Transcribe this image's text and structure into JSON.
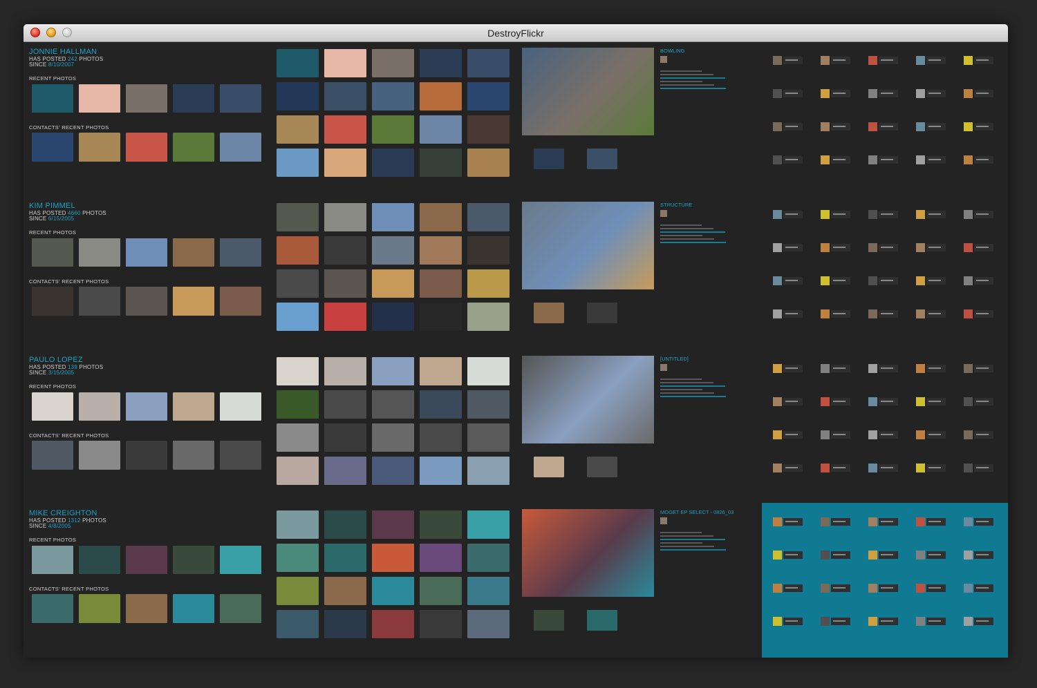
{
  "window": {
    "title": "DestroyFlickr"
  },
  "sections": [
    {
      "name": "JONNIE HALLMAN",
      "posted_prefix": "HAS POSTED",
      "count": "242",
      "posted_suffix": "PHOTOS",
      "since_prefix": "SINCE",
      "since": "8/10/2007",
      "recent_label": "RECENT PHOTOS",
      "contacts_label": "CONTACTS' RECENT PHOTOS",
      "photo_title": "BOWLING"
    },
    {
      "name": "KIM PIMMEL",
      "posted_prefix": "HAS POSTED",
      "count": "4660",
      "posted_suffix": "PHOTOS",
      "since_prefix": "SINCE",
      "since": "6/15/2005",
      "recent_label": "RECENT PHOTOS",
      "contacts_label": "CONTACTS' RECENT PHOTOS",
      "photo_title": "STRUCTURE"
    },
    {
      "name": "PAULO LOPEZ",
      "posted_prefix": "HAS POSTED",
      "count": "139",
      "posted_suffix": "PHOTOS",
      "since_prefix": "SINCE",
      "since": "3/15/2005",
      "recent_label": "RECENT PHOTOS",
      "contacts_label": "CONTACTS' RECENT PHOTOS",
      "photo_title": "[UNTITLED]"
    },
    {
      "name": "MIKE CREIGHTON",
      "posted_prefix": "HAS POSTED",
      "count": "1312",
      "posted_suffix": "PHOTOS",
      "since_prefix": "SINCE",
      "since": "4/8/2005",
      "recent_label": "RECENT PHOTOS",
      "contacts_label": "CONTACTS' RECENT PHOTOS",
      "photo_title": "MOGET EP SELECT - 0826_03"
    }
  ],
  "colors": {
    "accent": "#1aa3c4",
    "background": "#232323",
    "teal_panel": "#0f7a92"
  },
  "icons": [
    "close-icon",
    "minimize-icon",
    "zoom-icon"
  ]
}
